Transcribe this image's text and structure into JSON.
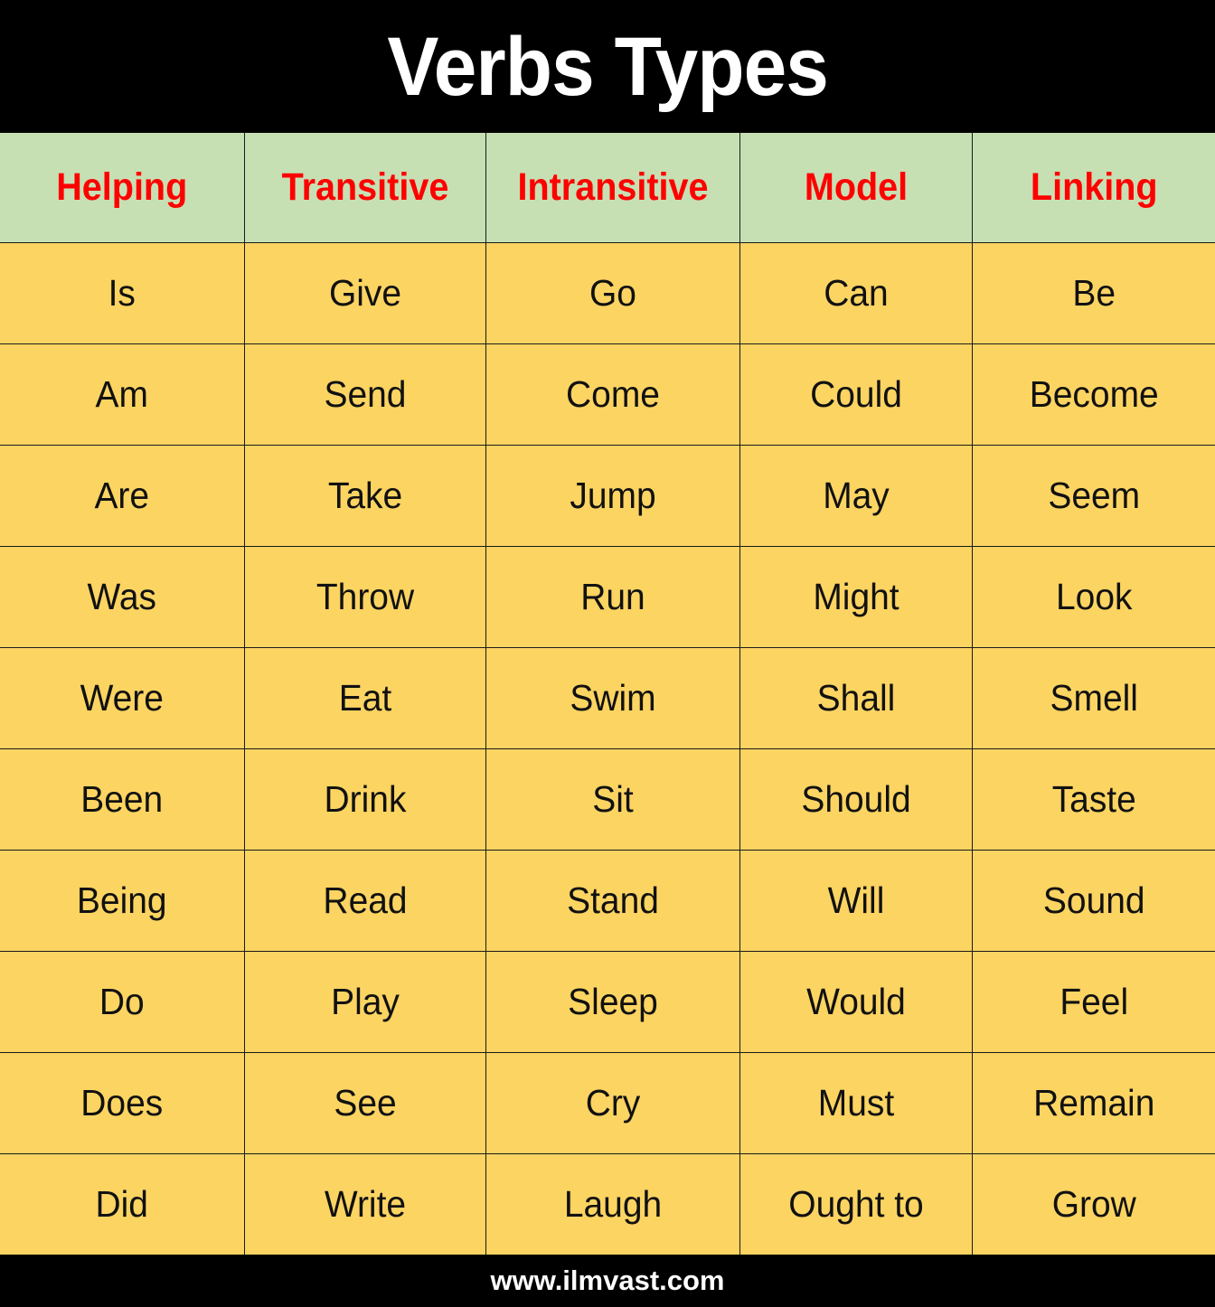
{
  "title": "Verbs Types",
  "footer": "www.ilmvast.com",
  "colors": {
    "title_band_bg": "#000000",
    "title_text": "#FFFFFF",
    "header_row_bg": "#C6E0B4",
    "header_text": "#FF0000",
    "body_cell_bg": "#FCD462",
    "body_text": "#111111",
    "grid_line": "#1A1A1A",
    "footer_band_bg": "#000000",
    "footer_text": "#FFFFFF"
  },
  "table": {
    "headers": [
      "Helping",
      "Transitive",
      "Intransitive",
      "Model",
      "Linking"
    ],
    "rows": [
      [
        "Is",
        "Give",
        "Go",
        "Can",
        "Be"
      ],
      [
        "Am",
        "Send",
        "Come",
        "Could",
        "Become"
      ],
      [
        "Are",
        "Take",
        "Jump",
        "May",
        "Seem"
      ],
      [
        "Was",
        "Throw",
        "Run",
        "Might",
        "Look"
      ],
      [
        "Were",
        "Eat",
        "Swim",
        "Shall",
        "Smell"
      ],
      [
        "Been",
        "Drink",
        "Sit",
        "Should",
        "Taste"
      ],
      [
        "Being",
        "Read",
        "Stand",
        "Will",
        "Sound"
      ],
      [
        "Do",
        "Play",
        "Sleep",
        "Would",
        "Feel"
      ],
      [
        "Does",
        "See",
        "Cry",
        "Must",
        "Remain"
      ],
      [
        "Did",
        "Write",
        "Laugh",
        "Ought to",
        "Grow"
      ]
    ]
  }
}
